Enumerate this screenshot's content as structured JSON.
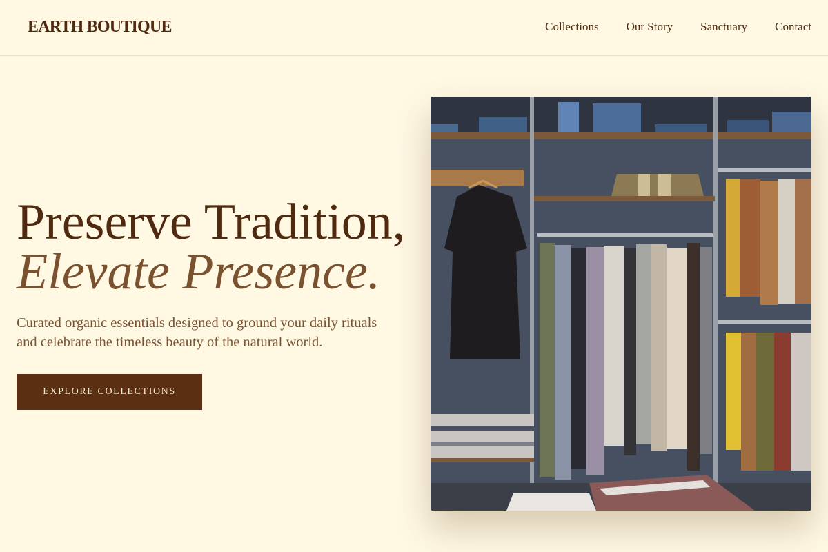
{
  "brand": {
    "name": "EARTH BOUTIQUE"
  },
  "nav": {
    "items": [
      "Collections",
      "Our Story",
      "Sanctuary",
      "Contact"
    ]
  },
  "hero": {
    "title_line1": "Preserve Tradition,",
    "title_line2": "Elevate Presence.",
    "subtitle": "Curated organic essentials designed to ground your daily rituals and celebrate the timeless beauty of the natural world.",
    "cta_label": "EXPLORE COLLECTIONS"
  },
  "colors": {
    "background": "#fff8e3",
    "primary_text": "#4f2a10",
    "accent_text": "#7a5230",
    "button_bg": "#5b2f11",
    "button_text": "#fbe9cf"
  }
}
